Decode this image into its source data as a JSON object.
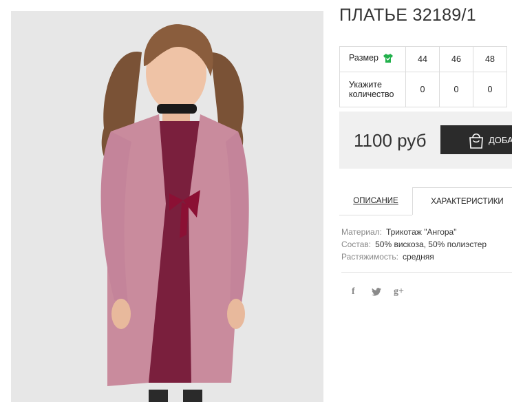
{
  "product": {
    "title": "ПЛАТЬЕ 32189/1",
    "photo_alt": "product-photo"
  },
  "sizes": {
    "size_label": "Размер",
    "qty_label_line1": "Укажите",
    "qty_label_line2": "количество",
    "values": [
      "44",
      "46",
      "48"
    ],
    "quantities": [
      "0",
      "0",
      "0"
    ],
    "size_icon": "tshirt-icon",
    "size_icon_color": "#22b14c"
  },
  "purchase": {
    "price": "1100 руб",
    "cart_label": "ДОБАВИТЬ В КОРЗИНУ",
    "cart_icon": "shopping-bag-icon",
    "button_color": "#2b2b2b"
  },
  "tabs": {
    "description": "ОПИСАНИЕ",
    "characteristics": "ХАРАКТЕРИСТИКИ"
  },
  "specs": [
    {
      "key": "Материал:",
      "value": "Трикотаж \"Ангора\""
    },
    {
      "key": "Состав:",
      "value": "50% вискоза, 50% полиэстер"
    },
    {
      "key": "Растяжимость:",
      "value": "средняя"
    }
  ],
  "social": {
    "facebook": "f",
    "twitter": "twitter-icon",
    "googleplus": "g+"
  }
}
